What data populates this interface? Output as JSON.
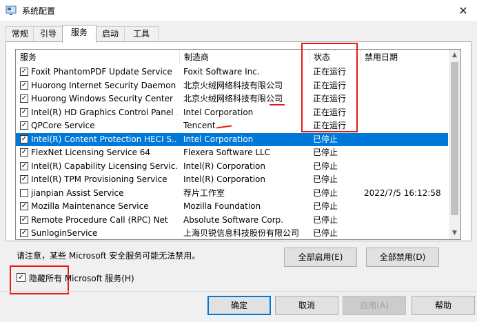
{
  "window": {
    "title": "系统配置",
    "close_icon": "close-icon"
  },
  "tabs": [
    {
      "label": "常规",
      "active": false
    },
    {
      "label": "引导",
      "active": false
    },
    {
      "label": "服务",
      "active": true
    },
    {
      "label": "启动",
      "active": false
    },
    {
      "label": "工具",
      "active": false
    }
  ],
  "table": {
    "columns": [
      "服务",
      "制造商",
      "状态",
      "禁用日期"
    ],
    "rows": [
      {
        "checked": true,
        "name": "Foxit PhantomPDF Update Service",
        "vendor": "Foxit Software Inc.",
        "status": "正在运行",
        "date": ""
      },
      {
        "checked": true,
        "name": "Huorong Internet Security Daemon",
        "vendor": "北京火绒网络科技有限公司",
        "status": "正在运行",
        "date": ""
      },
      {
        "checked": true,
        "name": "Huorong Windows Security Center",
        "vendor": "北京火绒网络科技有限公司",
        "status": "正在运行",
        "date": ""
      },
      {
        "checked": true,
        "name": "Intel(R) HD Graphics Control Panel ...",
        "vendor": "Intel Corporation",
        "status": "正在运行",
        "date": ""
      },
      {
        "checked": true,
        "name": "QPCore Service",
        "vendor": "Tencent",
        "status": "正在运行",
        "date": ""
      },
      {
        "checked": true,
        "name": "Intel(R) Content Protection HECI S...",
        "vendor": "Intel Corporation",
        "status": "已停止",
        "date": "",
        "selected": true
      },
      {
        "checked": true,
        "name": "FlexNet Licensing Service 64",
        "vendor": "Flexera Software LLC",
        "status": "已停止",
        "date": ""
      },
      {
        "checked": true,
        "name": "Intel(R) Capability Licensing Servic...",
        "vendor": "Intel(R) Corporation",
        "status": "已停止",
        "date": ""
      },
      {
        "checked": true,
        "name": "Intel(R) TPM Provisioning Service",
        "vendor": "Intel(R) Corporation",
        "status": "已停止",
        "date": ""
      },
      {
        "checked": false,
        "name": "jianpian Assist Service",
        "vendor": "荐片工作室",
        "status": "已停止",
        "date": "2022/7/5 16:12:58"
      },
      {
        "checked": true,
        "name": "Mozilla Maintenance Service",
        "vendor": "Mozilla Foundation",
        "status": "已停止",
        "date": ""
      },
      {
        "checked": true,
        "name": "Remote Procedure Call (RPC) Net",
        "vendor": "Absolute Software Corp.",
        "status": "已停止",
        "date": ""
      },
      {
        "checked": true,
        "name": "SunloginService",
        "vendor": "上海贝锐信息科技股份有限公司",
        "status": "已停止",
        "date": ""
      }
    ]
  },
  "note": "请注意，某些 Microsoft 安全服务可能无法禁用。",
  "buttons": {
    "enable_all": "全部启用(E)",
    "disable_all": "全部禁用(D)",
    "ok": "确定",
    "cancel": "取消",
    "apply": "应用(A)",
    "help": "帮助"
  },
  "hide_ms": {
    "label": "隐藏所有 Microsoft 服务(H)",
    "checked": true
  },
  "colors": {
    "selection": "#0078d7",
    "annotation_red": "#e21a1a"
  }
}
